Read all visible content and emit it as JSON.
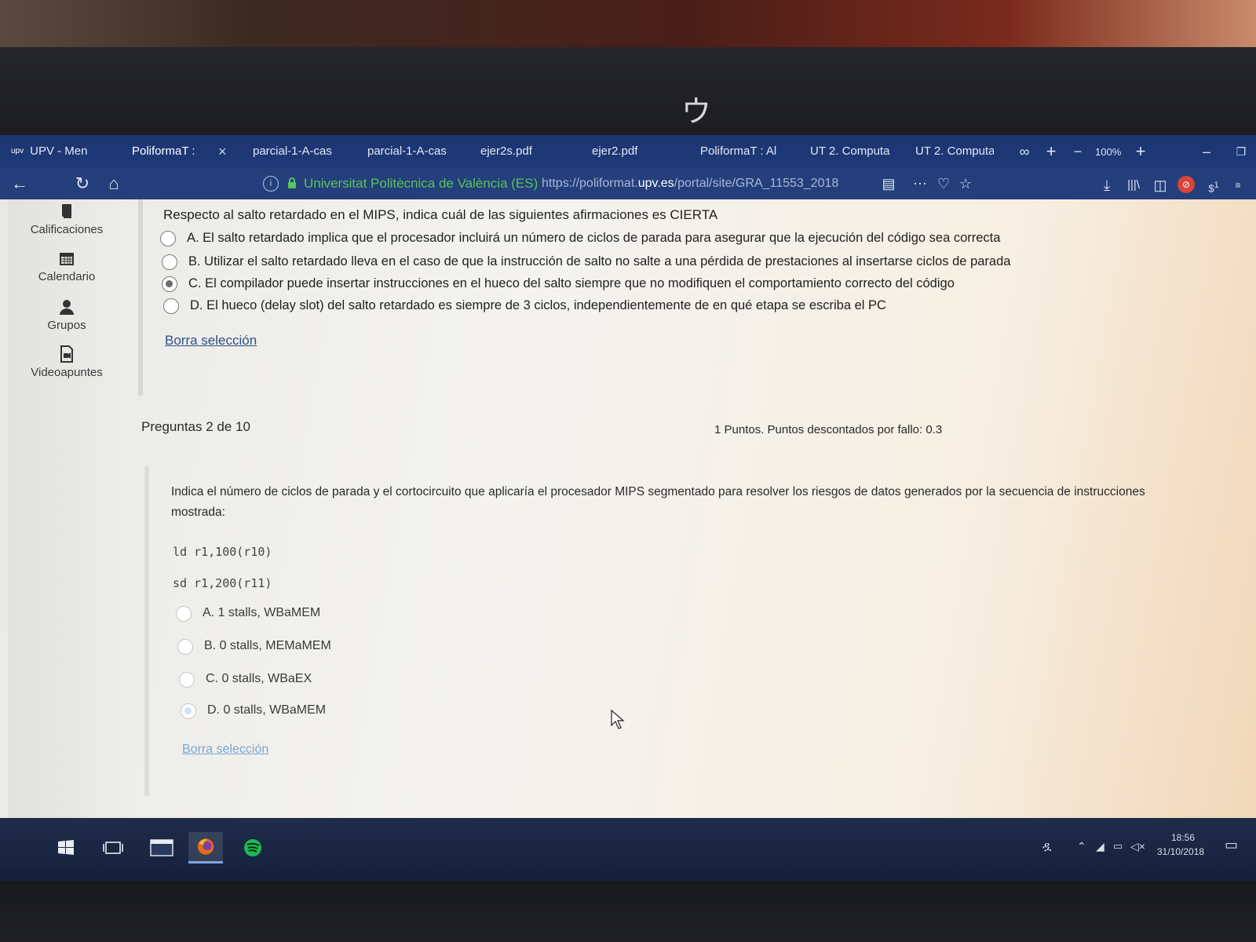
{
  "browser": {
    "tabs": [
      {
        "label": "UPV - Men",
        "favicon": "upv"
      },
      {
        "label": "PoliformaT :",
        "active": true
      },
      {
        "label": "parcial-1-A-cas"
      },
      {
        "label": "parcial-1-A-cas"
      },
      {
        "label": "ejer2s.pdf"
      },
      {
        "label": "ejer2.pdf"
      },
      {
        "label": "PoliformaT : Al"
      },
      {
        "label": "UT 2. Computa"
      },
      {
        "label": "UT 2. Computa"
      }
    ],
    "tab_close": "×",
    "new_tab": "+",
    "zoom": "100%",
    "url_org": "Universitat Politècnica de València (ES)",
    "url_prefix": "https://poliformat.",
    "url_domain": "upv.es",
    "url_path": "/portal/site/GRA_11553_2018",
    "notification_count": "1"
  },
  "sidebar": {
    "items": [
      {
        "label": "Calificaciones",
        "icon": "book-icon"
      },
      {
        "label": "Calendario",
        "icon": "calendar-icon"
      },
      {
        "label": "Grupos",
        "icon": "user-icon"
      },
      {
        "label": "Videoapuntes",
        "icon": "video-doc-icon"
      }
    ]
  },
  "question1": {
    "stem": "Respecto al salto retardado en el MIPS, indica cuál de las siguientes afirmaciones es CIERTA",
    "options": [
      {
        "text": "A. El salto retardado implica que el procesador incluirá un número de ciclos de parada para asegurar que la ejecución del código sea correcta",
        "selected": false
      },
      {
        "text": "B. Utilizar el salto retardado lleva en el caso de que la instrucción de salto no salte a una pérdida de prestaciones al insertarse ciclos de parada",
        "selected": false
      },
      {
        "text": "C. El compilador puede insertar instrucciones en el hueco del salto siempre que no modifiquen el comportamiento correcto del código",
        "selected": true
      },
      {
        "text": "D. El hueco (delay slot) del salto retardado es siempre de 3 ciclos, independientemente de en qué etapa se escriba el PC",
        "selected": false
      }
    ],
    "clear": "Borra selección"
  },
  "question2": {
    "counter": "Preguntas 2 de 10",
    "points": "1 Puntos. Puntos descontados por fallo: 0.3",
    "stem": "Indica el número de ciclos de parada y el cortocircuito que aplicaría el procesador MIPS segmentado para resolver los riesgos de datos generados por la secuencia de instrucciones mostrada:",
    "code": [
      "ld r1,100(r10)",
      "sd r1,200(r11)"
    ],
    "options": [
      {
        "text": "A. 1 stalls, WBaMEM",
        "selected": false
      },
      {
        "text": "B. 0 stalls, MEMaMEM",
        "selected": false
      },
      {
        "text": "C. 0 stalls, WBaEX",
        "selected": false
      },
      {
        "text": "D. 0 stalls, WBaMEM",
        "selected": true
      }
    ],
    "clear": "Borra selección"
  },
  "taskbar": {
    "time": "18:56",
    "date": "31/10/2018"
  },
  "colors": {
    "browser_chrome": "#1f3a78",
    "secure_green": "#59c45a",
    "link": "#2d4f86",
    "taskbar": "#1a2642"
  }
}
